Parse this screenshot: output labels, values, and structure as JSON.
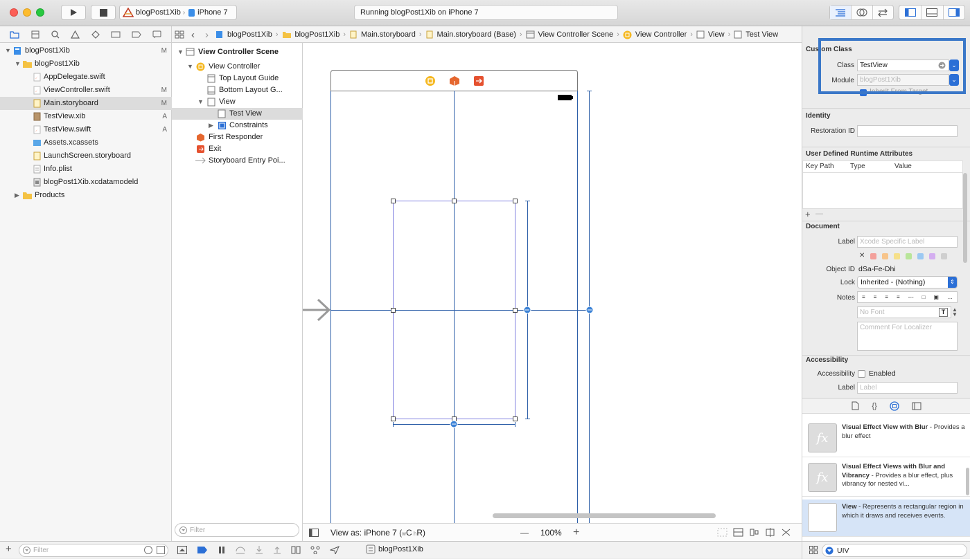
{
  "toolbar": {
    "scheme": "blogPost1Xib",
    "device": "iPhone 7",
    "activity": "Running blogPost1Xib on iPhone 7"
  },
  "jumpbar": [
    "blogPost1Xib",
    "blogPost1Xib",
    "Main.storyboard",
    "Main.storyboard (Base)",
    "View Controller Scene",
    "View Controller",
    "View",
    "Test View"
  ],
  "navigator": {
    "items": [
      {
        "label": "blogPost1Xib",
        "status": "M"
      },
      {
        "label": "blogPost1Xib",
        "status": ""
      },
      {
        "label": "AppDelegate.swift",
        "status": ""
      },
      {
        "label": "ViewController.swift",
        "status": "M"
      },
      {
        "label": "Main.storyboard",
        "status": "M"
      },
      {
        "label": "TestView.xib",
        "status": "A"
      },
      {
        "label": "TestView.swift",
        "status": "A"
      },
      {
        "label": "Assets.xcassets",
        "status": ""
      },
      {
        "label": "LaunchScreen.storyboard",
        "status": ""
      },
      {
        "label": "Info.plist",
        "status": ""
      },
      {
        "label": "blogPost1Xib.xcdatamodeld",
        "status": ""
      },
      {
        "label": "Products",
        "status": ""
      }
    ],
    "filter_placeholder": "Filter"
  },
  "outline": {
    "items": [
      "View Controller Scene",
      "View Controller",
      "Top Layout Guide",
      "Bottom Layout G...",
      "View",
      "Test View",
      "Constraints",
      "First Responder",
      "Exit",
      "Storyboard Entry Poi..."
    ],
    "filter_placeholder": "Filter"
  },
  "canvas": {
    "view_as": "View as: iPhone 7 (",
    "size_w": "w",
    "size_c": "C",
    "size_h": "h",
    "size_r": "R",
    "view_as_end": ")",
    "zoom": "100%",
    "zoom_out": "—",
    "zoom_in": "+"
  },
  "inspector": {
    "custom_class": {
      "header": "Custom Class",
      "class_label": "Class",
      "class_value": "TestView",
      "module_label": "Module",
      "module_placeholder": "blogPost1Xib",
      "inherit": "Inherit From Target"
    },
    "identity": {
      "header": "Identity",
      "restoration_label": "Restoration ID"
    },
    "runtime": {
      "header": "User Defined Runtime Attributes",
      "col_key": "Key Path",
      "col_type": "Type",
      "col_value": "Value",
      "add": "+",
      "remove": "—"
    },
    "document": {
      "header": "Document",
      "label_label": "Label",
      "label_placeholder": "Xcode Specific Label",
      "object_id_label": "Object ID",
      "object_id": "dSa-Fe-Dhi",
      "lock_label": "Lock",
      "lock_value": "Inherited - (Nothing)",
      "notes_label": "Notes",
      "font_placeholder": "No Font",
      "comment_placeholder": "Comment For Localizer",
      "clear_mark": "✕"
    },
    "accessibility": {
      "header": "Accessibility",
      "accessibility_label": "Accessibility",
      "enabled": "Enabled",
      "label_label": "Label",
      "label_placeholder": "Label"
    }
  },
  "library": {
    "items": [
      {
        "title": "Visual Effect View with Blur",
        "desc": " - Provides a blur effect"
      },
      {
        "title": "Visual Effect Views with Blur and Vibrancy",
        "desc": " - Provides a blur effect, plus vibrancy for nested vi..."
      },
      {
        "title": "View",
        "desc": " - Represents a rectangular region in which it draws and receives events."
      }
    ],
    "filter_value": "UIV"
  },
  "bottom": {
    "scheme": "blogPost1Xib"
  },
  "colors": {
    "accent": "#2b6fd6",
    "highlight_box": "#3a77c8",
    "constraint": "#2d5fa8"
  }
}
